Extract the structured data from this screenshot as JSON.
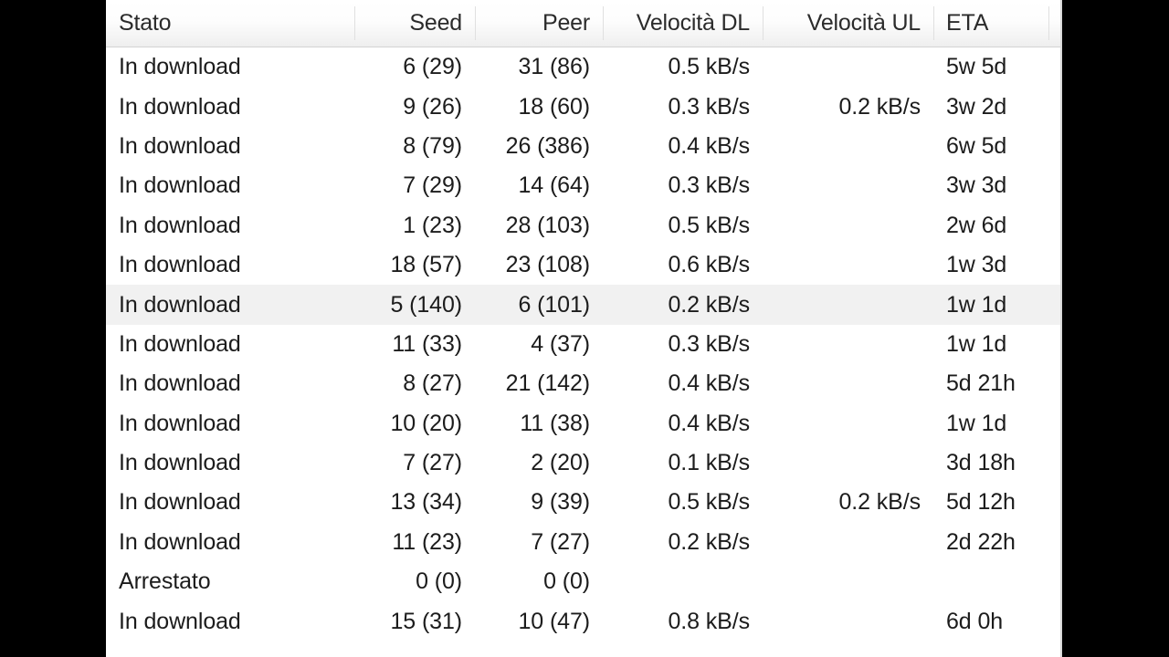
{
  "app": {
    "title": "Torrent transfer list",
    "language": "it"
  },
  "table": {
    "columns": [
      {
        "key": "stato",
        "label": "Stato",
        "align": "left"
      },
      {
        "key": "seed",
        "label": "Seed",
        "align": "right"
      },
      {
        "key": "peer",
        "label": "Peer",
        "align": "right"
      },
      {
        "key": "dl",
        "label": "Velocità DL",
        "align": "right"
      },
      {
        "key": "ul",
        "label": "Velocità UL",
        "align": "right"
      },
      {
        "key": "eta",
        "label": "ETA",
        "align": "left"
      }
    ],
    "selected_row_index": 6,
    "selected_row_color": "#f1f1f1",
    "rows": [
      {
        "stato": "In download",
        "seed": "6 (29)",
        "peer": "31 (86)",
        "dl": "0.5 kB/s",
        "ul": "",
        "eta": "5w 5d"
      },
      {
        "stato": "In download",
        "seed": "9 (26)",
        "peer": "18 (60)",
        "dl": "0.3 kB/s",
        "ul": "0.2 kB/s",
        "eta": "3w 2d"
      },
      {
        "stato": "In download",
        "seed": "8 (79)",
        "peer": "26 (386)",
        "dl": "0.4 kB/s",
        "ul": "",
        "eta": "6w 5d"
      },
      {
        "stato": "In download",
        "seed": "7 (29)",
        "peer": "14 (64)",
        "dl": "0.3 kB/s",
        "ul": "",
        "eta": "3w 3d"
      },
      {
        "stato": "In download",
        "seed": "1 (23)",
        "peer": "28 (103)",
        "dl": "0.5 kB/s",
        "ul": "",
        "eta": "2w 6d"
      },
      {
        "stato": "In download",
        "seed": "18 (57)",
        "peer": "23 (108)",
        "dl": "0.6 kB/s",
        "ul": "",
        "eta": "1w 3d"
      },
      {
        "stato": "In download",
        "seed": "5 (140)",
        "peer": "6 (101)",
        "dl": "0.2 kB/s",
        "ul": "",
        "eta": "1w 1d"
      },
      {
        "stato": "In download",
        "seed": "11 (33)",
        "peer": "4 (37)",
        "dl": "0.3 kB/s",
        "ul": "",
        "eta": "1w 1d"
      },
      {
        "stato": "In download",
        "seed": "8 (27)",
        "peer": "21 (142)",
        "dl": "0.4 kB/s",
        "ul": "",
        "eta": "5d 21h"
      },
      {
        "stato": "In download",
        "seed": "10 (20)",
        "peer": "11 (38)",
        "dl": "0.4 kB/s",
        "ul": "",
        "eta": "1w 1d"
      },
      {
        "stato": "In download",
        "seed": "7 (27)",
        "peer": "2 (20)",
        "dl": "0.1 kB/s",
        "ul": "",
        "eta": "3d 18h"
      },
      {
        "stato": "In download",
        "seed": "13 (34)",
        "peer": "9 (39)",
        "dl": "0.5 kB/s",
        "ul": "0.2 kB/s",
        "eta": "5d 12h"
      },
      {
        "stato": "In download",
        "seed": "11 (23)",
        "peer": "7 (27)",
        "dl": "0.2 kB/s",
        "ul": "",
        "eta": "2d 22h"
      },
      {
        "stato": "Arrestato",
        "seed": "0 (0)",
        "peer": "0 (0)",
        "dl": "",
        "ul": "",
        "eta": ""
      },
      {
        "stato": "In download",
        "seed": "15 (31)",
        "peer": "10 (47)",
        "dl": "0.8 kB/s",
        "ul": "",
        "eta": "6d 0h"
      }
    ]
  },
  "colors": {
    "panel_background": "#ffffff",
    "header_background": "#f4f4f4",
    "header_border": "#d4d4d4",
    "text": "#1c1c1c",
    "letterbox": "#000000"
  }
}
